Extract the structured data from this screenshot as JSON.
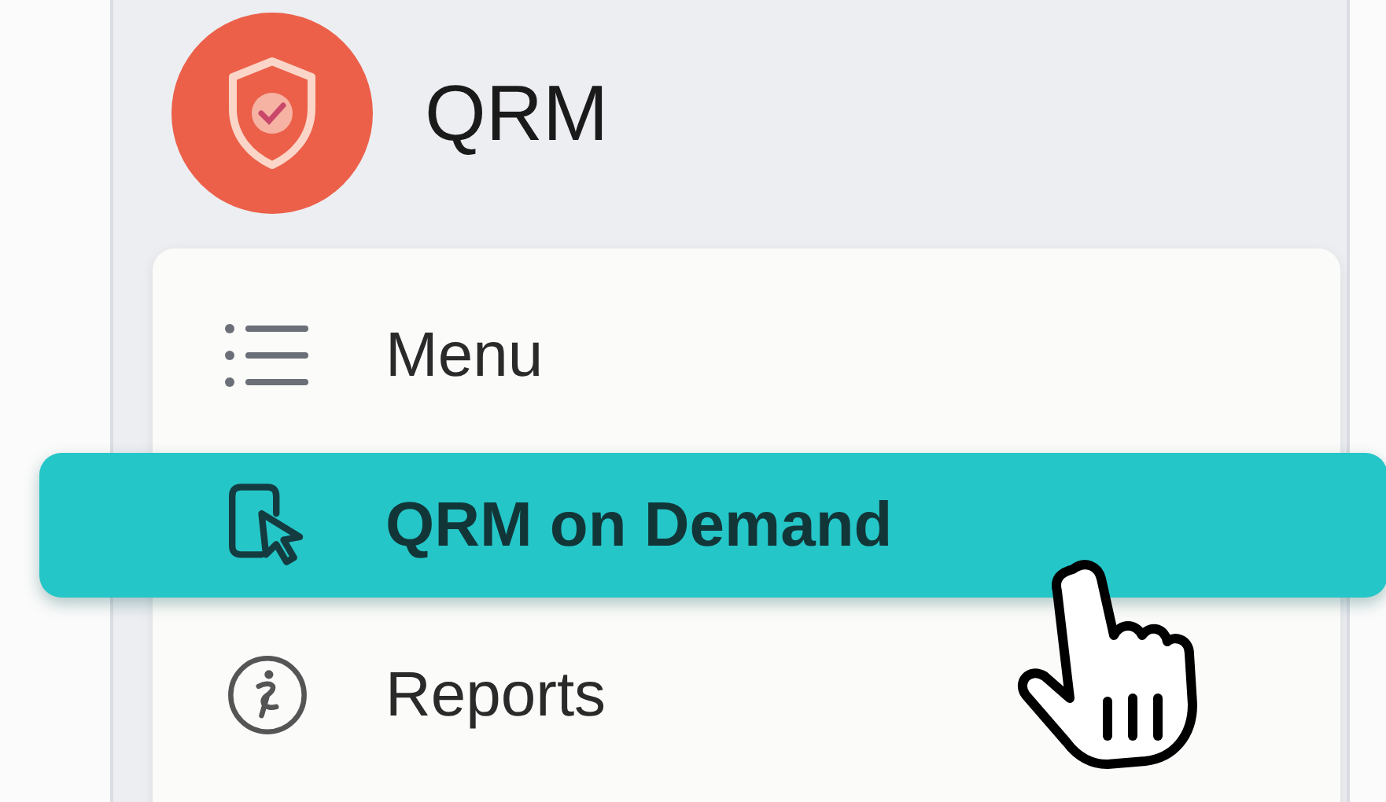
{
  "brand": {
    "title": "QRM"
  },
  "nav_items": [
    {
      "label": "Menu",
      "kind": "list",
      "selected": false
    },
    {
      "label": "QRM on Demand",
      "kind": "device",
      "selected": true
    },
    {
      "label": "Reports",
      "kind": "figure",
      "selected": false
    }
  ]
}
